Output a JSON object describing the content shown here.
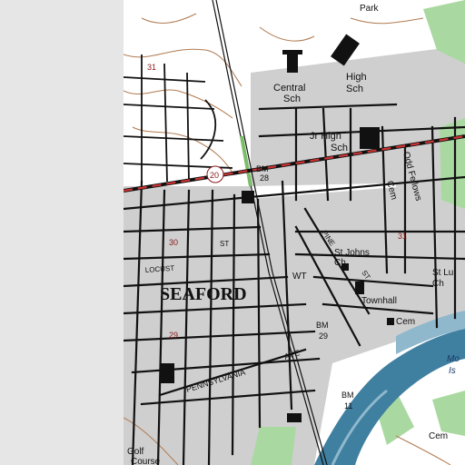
{
  "map": {
    "colors": {
      "paper": "#ffffff",
      "urban_tint": "#c9c9c9",
      "water": "#3f7fa0",
      "water_light": "#8fb8cc",
      "vegetation": "#a8d8a0",
      "road": "#111111",
      "highway": "#cc3333",
      "contour": "#b07a50"
    },
    "labels": {
      "town": "SEAFORD",
      "park": "Park",
      "central_line1": "Central",
      "central_line2": "Sch",
      "high_line1": "High",
      "high_line2": "Sch",
      "jrhigh_line1": "Jr High",
      "jrhigh_line2": "Sch",
      "oddfellows_line1": "Odd Fellows",
      "oddfellows_line2": "Cem",
      "stjohns_line1": "St Johns",
      "stjohns_line2": "Ch",
      "stluke_line1": "St Lu",
      "stluke_line2": "Ch",
      "townhall": "Townhall",
      "cem_right": "Cem",
      "cem_bottom": "Cem",
      "wt": "WT",
      "bm28_line1": "BM",
      "bm28_line2": "28",
      "bm29_line1": "BM",
      "bm29_line2": "29",
      "bm11_line1": "BM",
      "bm11_line2": "11",
      "route20": "20",
      "n31_top": "31",
      "n31_right": "31",
      "n30": "30",
      "n29": "29",
      "st": "ST",
      "locust": "LOCUST",
      "pine": "PINE",
      "st_pine": "ST",
      "pennsylvania": "PENNSYLVANIA",
      "ave": "AVE",
      "golf": "Golf",
      "course": "Course",
      "mo": "Mo",
      "is": "Is"
    }
  }
}
